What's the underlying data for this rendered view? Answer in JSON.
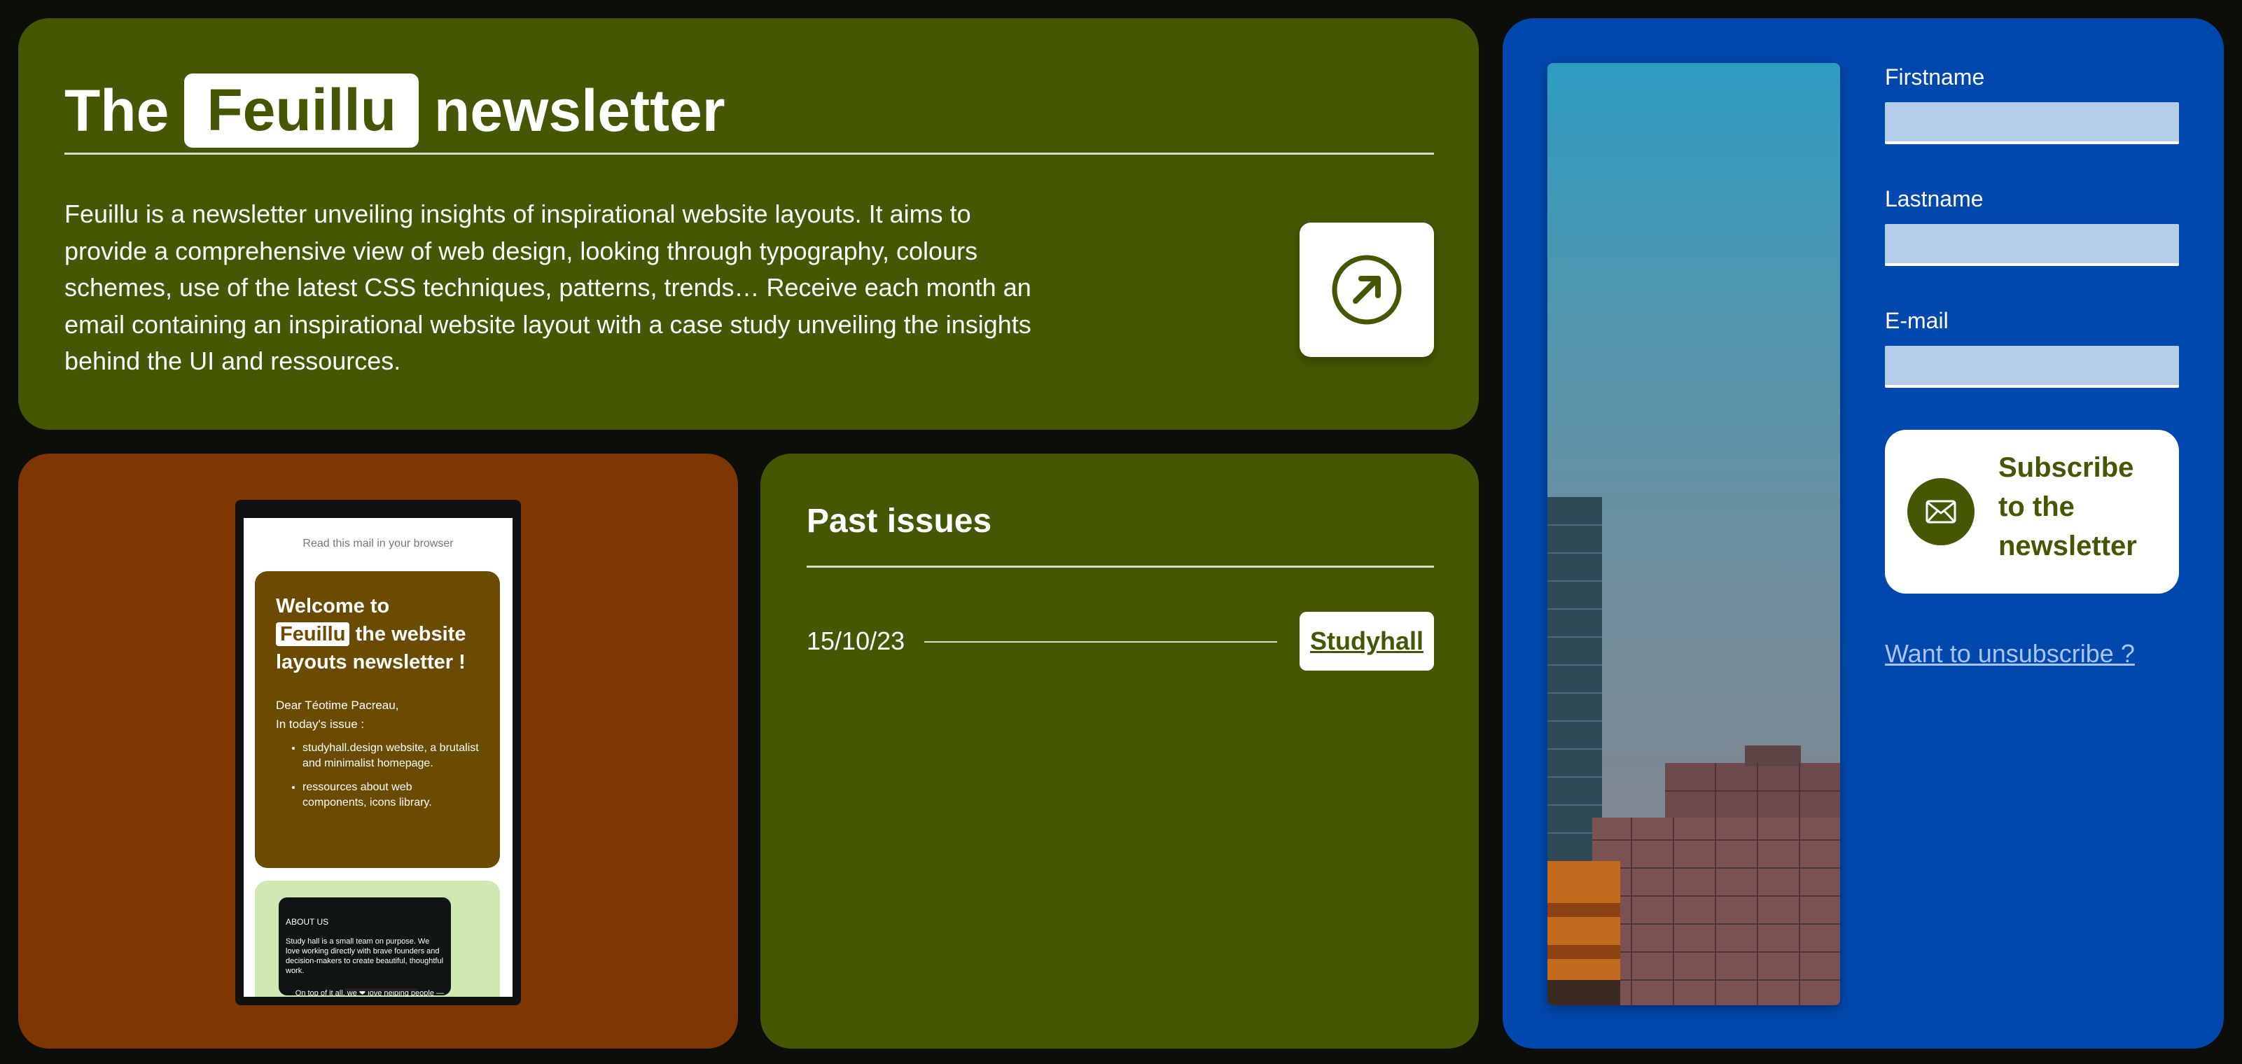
{
  "header": {
    "title_prefix": "The",
    "brand": "Feuillu",
    "title_suffix": "newsletter",
    "description": "Feuillu is a newsletter unveiling insights of inspirational website layouts. It aims to provide a comprehensive view of web design, looking through typography, colours schemes, use of the latest CSS techniques, patterns, trends… Receive each month an email containing an inspirational website layout with a case study unveiling the insights behind the UI and ressources.",
    "open_icon": "arrow-up-right-circle-icon"
  },
  "preview": {
    "browser_link": "Read this mail in your browser",
    "welcome_prefix": "Welcome to",
    "welcome_brand": "Feuillu",
    "welcome_suffix": "the website layouts newsletter !",
    "greeting": "Dear Téotime Pacreau,",
    "issue_intro": "In today's issue :",
    "items": [
      "studyhall.design website, a brutalist and minimalist homepage.",
      "ressources about web components, icons library."
    ],
    "about_heading": "ABOUT US",
    "about_text": "Study hall is a small team on purpose. We love working directly with brave founders and decision-makers to create beautiful, thoughtful work.",
    "about_more": "On top of it all, we ❤ love helping people — we're a"
  },
  "issues": {
    "title": "Past issues",
    "list": [
      {
        "date": "15/10/23",
        "name": "Studyhall"
      }
    ]
  },
  "subscribe": {
    "firstname_label": "Firstname",
    "firstname_value": "",
    "lastname_label": "Lastname",
    "lastname_value": "",
    "email_label": "E-mail",
    "email_value": "",
    "button_label": "Subscribe to the newsletter",
    "button_icon": "envelope-icon",
    "unsubscribe_label": "Want to unsubscribe ?"
  },
  "colors": {
    "page_bg": "#0b0e09",
    "olive": "#445702",
    "rust": "#7e3603",
    "blue": "#0048ad",
    "mail_brown": "#6b4b02",
    "mail_green": "#d0e9b4"
  }
}
